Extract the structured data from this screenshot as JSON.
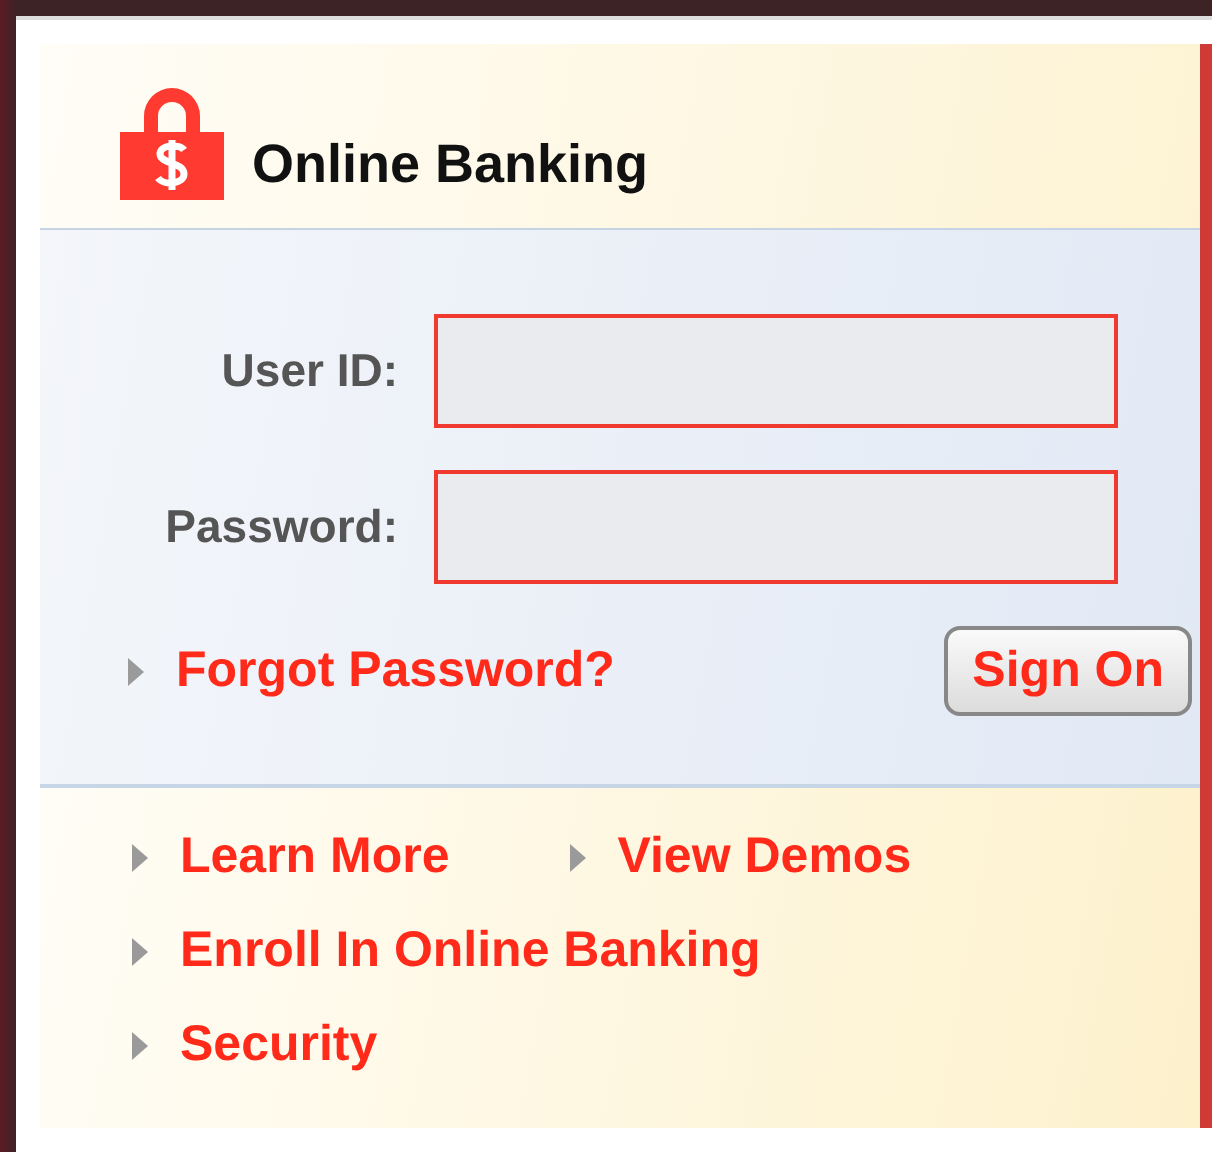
{
  "header": {
    "title": "Online Banking"
  },
  "form": {
    "fields": [
      {
        "label": "User ID:"
      },
      {
        "label": "Password:"
      }
    ],
    "forgot_link": "Forgot Password?",
    "submit_button": "Sign On"
  },
  "link_rows": [
    [
      {
        "label": "Learn More"
      },
      {
        "label": "View Demos"
      }
    ],
    [
      {
        "label": "Enroll In Online Banking"
      }
    ],
    [
      {
        "label": "Security"
      }
    ]
  ]
}
